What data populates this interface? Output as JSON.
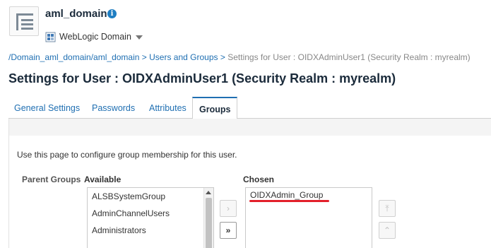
{
  "header": {
    "domain_title": "aml_domain",
    "info_glyph": "i",
    "weblogic_label": "WebLogic Domain",
    "icons": [
      "domain-icon",
      "info-icon",
      "weblogic-domain-icon",
      "caret-down-icon"
    ]
  },
  "breadcrumb": {
    "items": [
      {
        "label": "/Domain_aml_domain/aml_domain",
        "link": true
      },
      {
        "label": "Users and Groups",
        "link": true
      },
      {
        "label": "Settings for User : OIDXAdminUser1 (Security Realm : myrealm)",
        "link": false
      }
    ],
    "separator": ">"
  },
  "page_title": "Settings for User : OIDXAdminUser1 (Security Realm : myrealm)",
  "tabs": [
    {
      "label": "General Settings",
      "active": false
    },
    {
      "label": "Passwords",
      "active": false
    },
    {
      "label": "Attributes",
      "active": false
    },
    {
      "label": "Groups",
      "active": true
    }
  ],
  "groups_panel": {
    "description": "Use this page to configure group membership for this user.",
    "parent_groups_label": "Parent Groups",
    "available_label": "Available",
    "chosen_label": "Chosen",
    "available_items": [
      "ALSBSystemGroup",
      "AdminChannelUsers",
      "Administrators"
    ],
    "chosen_items": [
      "OIDXAdmin_Group"
    ],
    "move_glyph": "›",
    "move_all_glyph": "»",
    "move_top_glyph": "⤒",
    "move_up_glyph": "⌃",
    "highlight_color": "#e3202a"
  }
}
